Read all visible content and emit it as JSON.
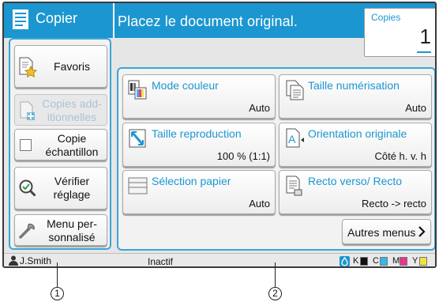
{
  "header": {
    "app_title": "Copier",
    "message": "Placez le document original.",
    "copies_label": "Copies",
    "copies_value": "1",
    "accent_color": "#1c96d0"
  },
  "left_panel": {
    "favorites": {
      "label": "Favoris",
      "icon": "star-document-icon"
    },
    "additional_copies": {
      "label": "Copies add-itionnelles",
      "icon": "add-document-icon",
      "enabled": false
    },
    "sample_copy": {
      "label": "Copie échantillon",
      "icon": "checkbox-icon",
      "checked": false
    },
    "check_settings": {
      "label": "Vérifier réglage",
      "icon": "magnifier-check-icon"
    },
    "custom_menu": {
      "label": "Menu per-sonnalisé",
      "icon": "wrench-icon"
    }
  },
  "functions": [
    {
      "title": "Mode couleur",
      "value": "Auto",
      "icon": "color-mode-icon"
    },
    {
      "title": "Taille numérisation",
      "value": "Auto",
      "icon": "scan-size-icon"
    },
    {
      "title": "Taille reproduction",
      "value": "100 % (1:1)",
      "icon": "reproduction-size-icon"
    },
    {
      "title": "Orientation originale",
      "value": "Côté h. v. h",
      "icon": "orientation-icon"
    },
    {
      "title": "Sélection papier",
      "value": "Auto",
      "icon": "paper-tray-icon"
    },
    {
      "title": "Recto verso/ Recto",
      "value": "Recto -> recto",
      "icon": "duplex-icon"
    }
  ],
  "more_menus": {
    "label": "Autres menus",
    "icon": "chevron-right-icon"
  },
  "status_bar": {
    "user": "J.Smith",
    "status": "Inactif",
    "ink": [
      {
        "label": "K",
        "color": "#111111"
      },
      {
        "label": "C",
        "color": "#35b8e8"
      },
      {
        "label": "M",
        "color": "#e8358f"
      },
      {
        "label": "Y",
        "color": "#f2e33c"
      }
    ]
  },
  "callouts": [
    "1",
    "2"
  ]
}
